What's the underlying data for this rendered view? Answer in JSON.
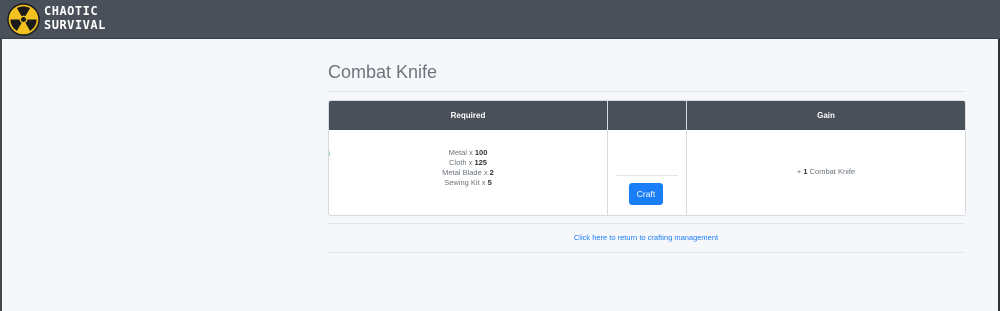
{
  "app": {
    "brand_line1": "CHAOTIC",
    "brand_line2": "SURVIVAL",
    "logo_icon": "radiation-icon"
  },
  "page": {
    "title": "Combat Knife"
  },
  "table": {
    "headers": {
      "required": "Required",
      "middle": "",
      "gain": "Gain"
    },
    "requirements": [
      {
        "name": "Metal x ",
        "qty": "100"
      },
      {
        "name": "Cloth x ",
        "qty": "125"
      },
      {
        "name": "Metal Blade x ",
        "qty": "2"
      },
      {
        "name": "Sewing Kit x ",
        "qty": "5"
      }
    ],
    "item_icon": "refresh-icon",
    "craft_label": "Craft",
    "gain": {
      "prefix": "+ ",
      "qty": "1",
      "item": " Combat Knife"
    }
  },
  "footer": {
    "return_link": "Click here to return to crafting management"
  },
  "colors": {
    "topbar": "#4a5059",
    "accent": "#1a7ef7",
    "logo_yellow": "#f3c221"
  }
}
